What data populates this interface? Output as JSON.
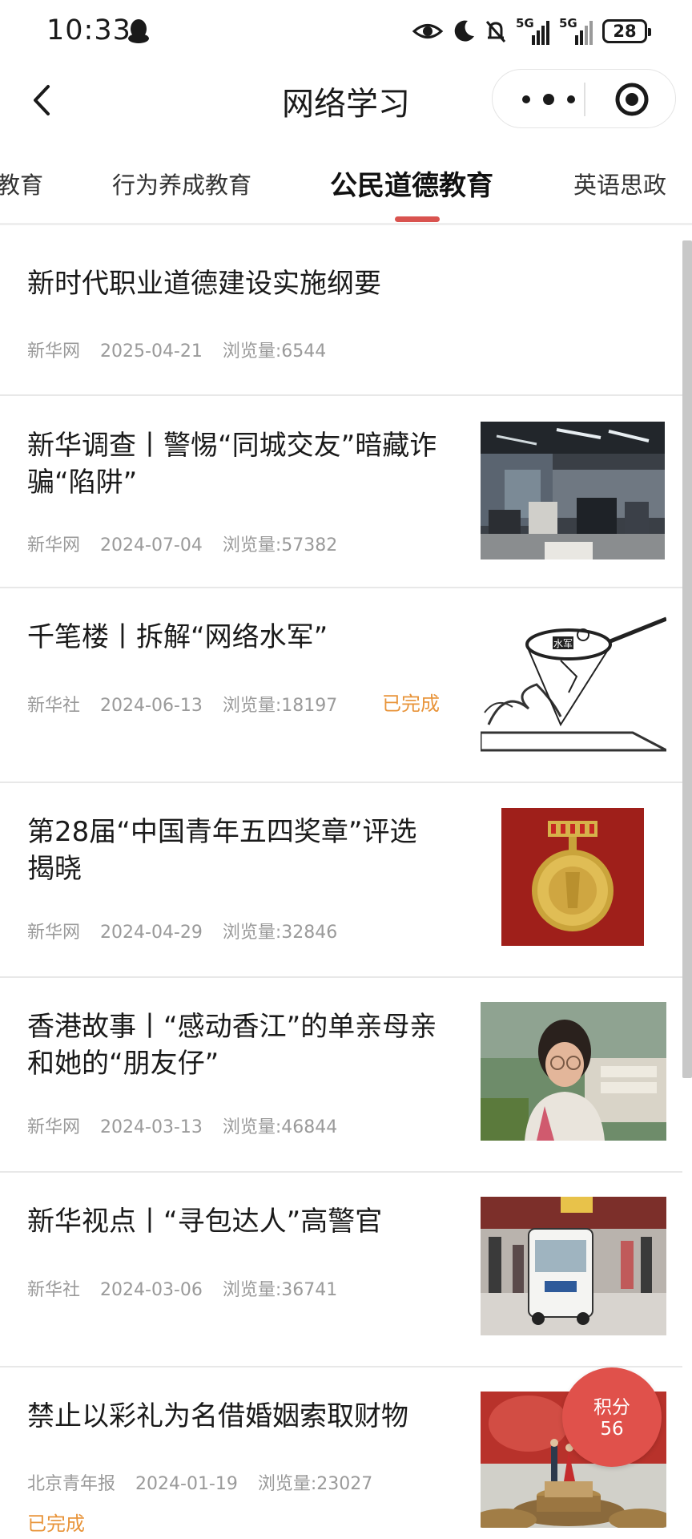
{
  "status_bar": {
    "time": "10:33",
    "icons": [
      "qq-penguin-icon",
      "eye-icon",
      "moon-icon",
      "bell-muted-icon",
      "signal-5g-icon",
      "signal-5g-icon"
    ],
    "network_1": "5G",
    "network_2": "5G",
    "battery": "28"
  },
  "nav": {
    "title": "网络学习",
    "back_icon": "chevron-left-icon",
    "menu_icon": "more-dots-icon",
    "close_icon": "target-icon"
  },
  "tabs": [
    {
      "label": "教育",
      "active": false
    },
    {
      "label": "行为养成教育",
      "active": false
    },
    {
      "label": "公民道德教育",
      "active": true
    },
    {
      "label": "英语思政",
      "active": false
    }
  ],
  "accent_color": "#d9534f",
  "done_color": "#e8943a",
  "articles": [
    {
      "title": "新时代职业道德建设实施纲要",
      "source": "新华网",
      "date": "2025-04-21",
      "views": "浏览量:6544",
      "done": ""
    },
    {
      "title": "新华调查丨警惕“同城交友”暗藏诈骗“陷阱”",
      "source": "新华网",
      "date": "2024-07-04",
      "views": "浏览量:57382",
      "done": "",
      "thumb": "office-room-photo"
    },
    {
      "title": "千笔楼丨拆解“网络水军”",
      "source": "新华社",
      "date": "2024-06-13",
      "views": "浏览量:18197",
      "done": "已完成",
      "thumb": "net-catching-cartoon",
      "thumb_text": "水军"
    },
    {
      "title": "第28届“中国青年五四奖章”评选揭晓",
      "source": "新华网",
      "date": "2024-04-29",
      "views": "浏览量:32846",
      "done": "",
      "thumb": "gold-medal-photo"
    },
    {
      "title": "香港故事丨“感动香江”的单亲母亲和她的“朋友仔”",
      "source": "新华网",
      "date": "2024-03-13",
      "views": "浏览量:46844",
      "done": "",
      "thumb": "woman-portrait-photo"
    },
    {
      "title": "新华视点丨“寻包达人”高警官",
      "source": "新华社",
      "date": "2024-03-06",
      "views": "浏览量:36741",
      "done": "",
      "thumb": "station-police-cart-photo"
    },
    {
      "title": "禁止以彩礼为名借婚姻索取财物",
      "source": "北京青年报",
      "date": "2024-01-19",
      "views": "浏览量:23027",
      "done": "已完成",
      "thumb": "couple-on-coins-photo"
    }
  ],
  "points": {
    "label": "积分",
    "value": "56"
  }
}
